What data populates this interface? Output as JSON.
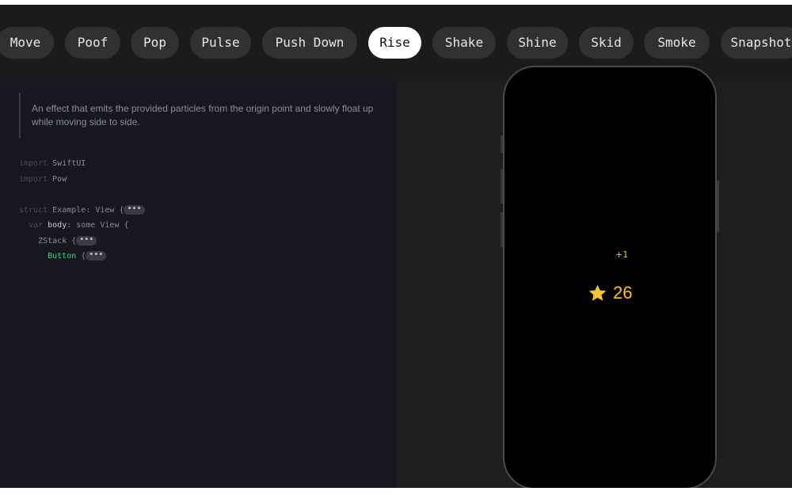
{
  "effects": {
    "chips": [
      {
        "label": "Move",
        "active": false
      },
      {
        "label": "Poof",
        "active": false
      },
      {
        "label": "Pop",
        "active": false
      },
      {
        "label": "Pulse",
        "active": false
      },
      {
        "label": "Push Down",
        "active": false
      },
      {
        "label": "Rise",
        "active": true
      },
      {
        "label": "Shake",
        "active": false
      },
      {
        "label": "Shine",
        "active": false
      },
      {
        "label": "Skid",
        "active": false
      },
      {
        "label": "Smoke",
        "active": false
      },
      {
        "label": "Snapshot",
        "active": false
      }
    ]
  },
  "doc": {
    "description": "An effect that emits the provided particles from the origin point and slowly float up while moving side to side."
  },
  "code": {
    "import_kw": "import",
    "import1": "SwiftUI",
    "import2": "Pow",
    "struct_kw": "struct",
    "struct_name": "Example",
    "struct_rest": ": View {",
    "var_kw": "var",
    "body_name": "body",
    "some_kw": ": some",
    "view_type": "View {",
    "zstack": "ZStack {",
    "button": "Button",
    "button_rest": " {",
    "fold": "•••"
  },
  "preview": {
    "count": "26",
    "particle": "+1",
    "accent": "#f4c430",
    "icon": "star-icon"
  }
}
